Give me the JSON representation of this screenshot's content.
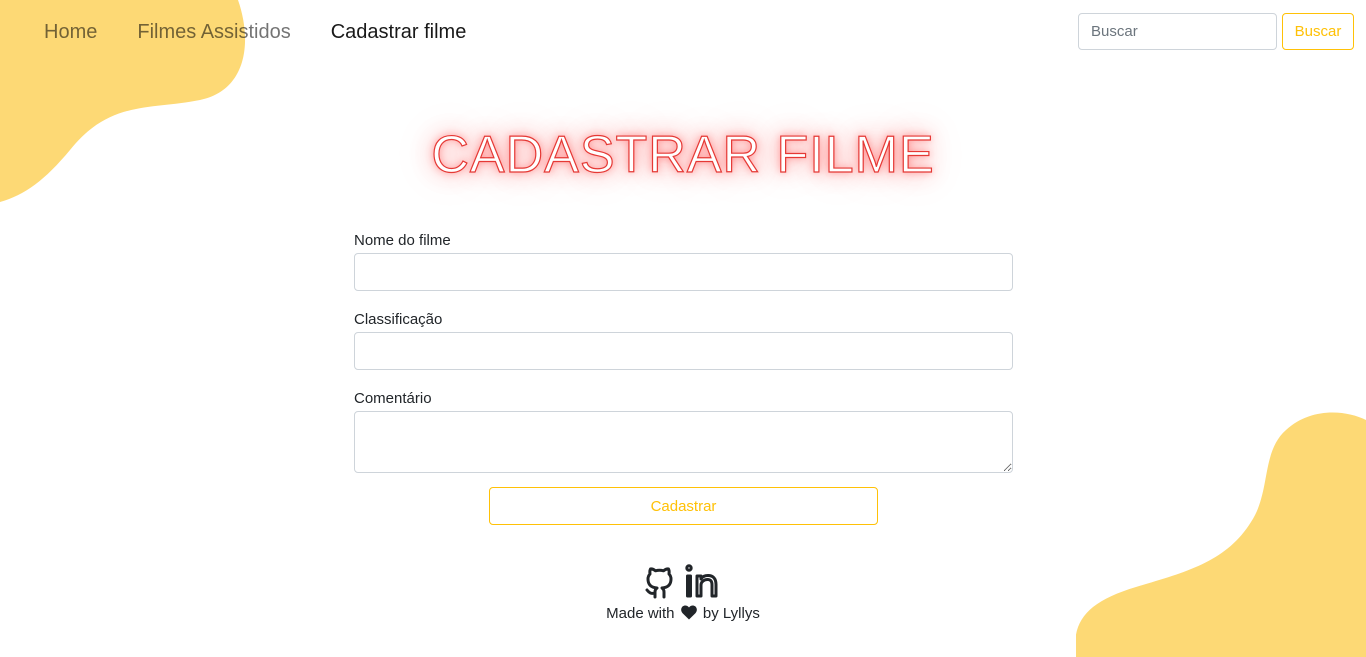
{
  "nav": {
    "links": [
      {
        "label": "Home"
      },
      {
        "label": "Filmes Assistidos"
      },
      {
        "label": "Cadastrar filme"
      }
    ],
    "search": {
      "placeholder": "Buscar",
      "button_label": "Buscar"
    }
  },
  "main": {
    "title": "CADASTRAR FILME",
    "form": {
      "name_label": "Nome do filme",
      "rating_label": "Classificação",
      "comment_label": "Comentário",
      "submit_label": "Cadastrar"
    }
  },
  "footer": {
    "icons": [
      "github-icon",
      "linkedin-icon",
      "heart-icon"
    ],
    "made_with": "Made with",
    "by": "by Lyllys"
  },
  "colors": {
    "accent": "#ffc107",
    "blob": "#fdd975",
    "title_neon": "#e53935"
  }
}
